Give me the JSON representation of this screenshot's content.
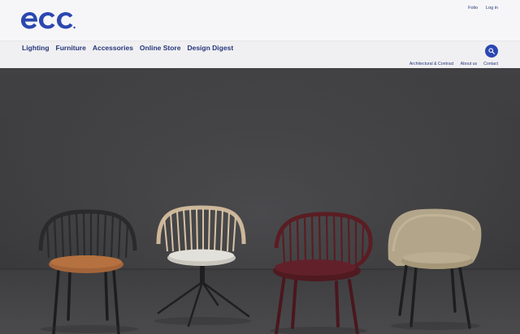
{
  "brand": {
    "logo_text": "ecc",
    "accent": "#2b47b0",
    "text_color": "#26367a"
  },
  "top_links": [
    "Folio",
    "Log in"
  ],
  "main_nav": [
    "Lighting",
    "Furniture",
    "Accessories",
    "Online Store",
    "Design Digest"
  ],
  "sub_nav": [
    "Architectural & Contract",
    "About us",
    "Contact"
  ],
  "search": {
    "icon": "search-icon"
  },
  "hero": {
    "chairs": [
      {
        "name": "black-spindle-chair",
        "seat_color": "#a4643a",
        "frame_color": "#2a2a2c"
      },
      {
        "name": "natural-spindle-swivel-chair",
        "seat_color": "#dedcd6",
        "frame_color": "#cdb79a"
      },
      {
        "name": "burgundy-spindle-chair",
        "seat_color": "#5f1f26",
        "frame_color": "#5a1d23"
      },
      {
        "name": "beige-upholstered-chair",
        "seat_color": "#b3a58a",
        "frame_color": "#1e1e20"
      }
    ]
  }
}
